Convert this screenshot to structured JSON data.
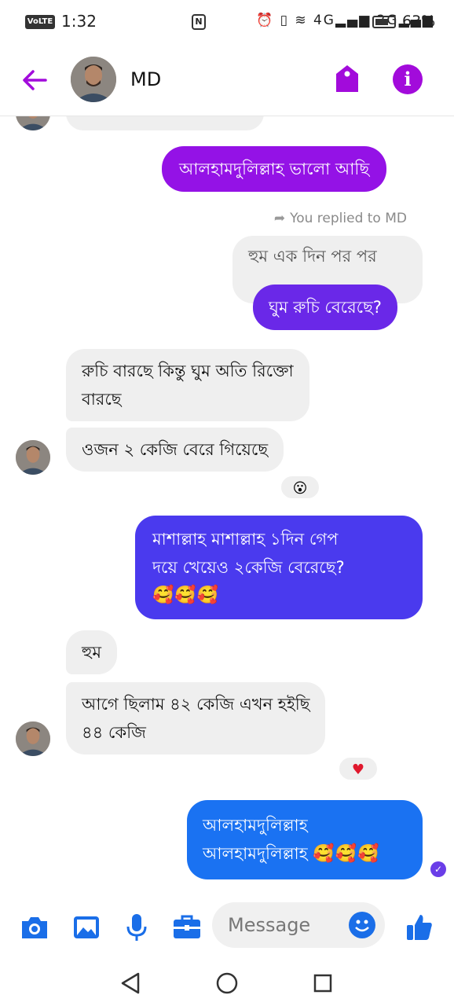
{
  "status_bar": {
    "volte": "VoLTE 1",
    "time": "1:32",
    "nfc": "N",
    "network_icons": "⏰ ▯ ≋ 4G▂▄▆ 2G▂▄▆",
    "battery": "63%"
  },
  "header": {
    "contact_name": "MD",
    "back_icon": "arrow-left-icon",
    "tag_icon": "tag-icon",
    "info_icon": "info-icon",
    "info_glyph": "i",
    "accent_color": "#a20bdb"
  },
  "messages": {
    "m1": "আলহামদুলিল্লাহ ভালো আছি",
    "replied_note": "You replied to MD",
    "reply_icon": "reply-arrow-icon",
    "m2_quoted": "হুম এক দিন পর পর",
    "m3": "ঘুম রুচি বেরেছে?",
    "m4_line1": "রুচি বারছে কিন্তু ঘুম অতি রিক্তো",
    "m4_line2": "বারছে",
    "m5": "ওজন ২ কেজি বেরে গিয়েছে",
    "m5_reaction": "😮",
    "m6_line1": "মাশাল্লাহ মাশাল্লাহ ১দিন গেপ",
    "m6_line2": "দয়ে খেয়েও ২কেজি বেরেছে?",
    "m6_emojis": "🥰🥰🥰",
    "m7": "হুম",
    "m8_line1": "আগে ছিলাম ৪২ কেজি এখন হইছি",
    "m8_line2": "৪৪ কেজি",
    "m8_reaction": "♥",
    "m9_line1": "আলহামদুলিল্লাহ",
    "m9_line2": "আলহামদুলিল্লাহ",
    "m9_emojis": "🥰🥰🥰",
    "seen_check": "✓"
  },
  "composer": {
    "placeholder": "Message",
    "icons": [
      "camera-icon",
      "gallery-icon",
      "microphone-icon",
      "toolbox-icon",
      "emoji-icon",
      "thumbs-up-icon"
    ],
    "accent_color": "#1a6ee8"
  },
  "nav": {
    "icons": [
      "back-triangle-icon",
      "home-circle-icon",
      "recents-square-icon"
    ]
  }
}
